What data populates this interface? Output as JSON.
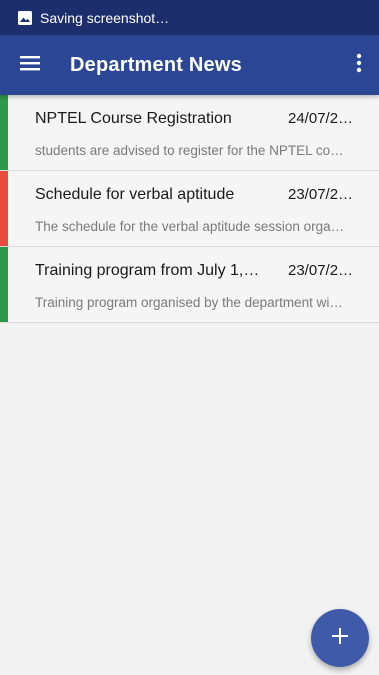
{
  "status_bar": {
    "text": "Saving screenshot…",
    "icon": "image-icon"
  },
  "app_bar": {
    "title": "Department News",
    "menu_icon": "hamburger-menu-icon",
    "more_icon": "more-vert-icon"
  },
  "news": [
    {
      "title": "NPTEL Course Registration",
      "date": "24/07/2…",
      "description": "students are advised to register for the NPTEL co…",
      "accent_color": "#2e9a48"
    },
    {
      "title": "Schedule for verbal aptitude",
      "date": "23/07/2…",
      "description": "The schedule for the verbal aptitude session orga…",
      "accent_color": "#ea4c3c"
    },
    {
      "title": "Training program from July 1, 2…",
      "date": "23/07/2…",
      "description": "Training program organised by the department wi…",
      "accent_color": "#2e9a48"
    }
  ],
  "fab": {
    "icon": "plus-icon"
  },
  "colors": {
    "status_bar": "#1c2f6c",
    "app_bar": "#2a4694",
    "fab": "#3e5aa8",
    "background": "#f2f2f2"
  }
}
